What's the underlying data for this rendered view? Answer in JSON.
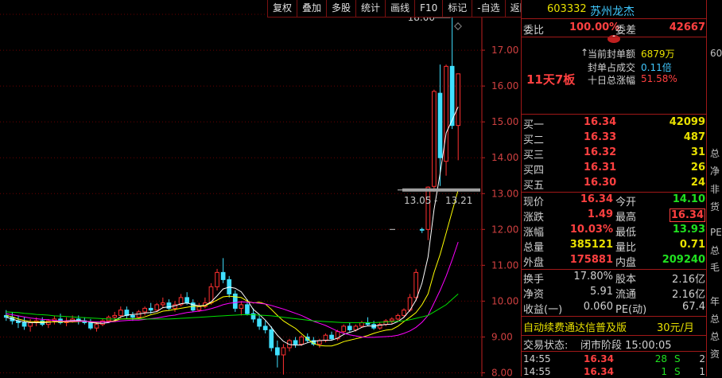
{
  "toolbar": [
    "复权",
    "叠加",
    "多股",
    "统计",
    "画线",
    "F10",
    "标记",
    "-自选",
    "返回"
  ],
  "stock": {
    "code": "603332",
    "name": "苏州龙杰"
  },
  "weibi": {
    "label": "委比",
    "pct": "100.00%",
    "diff_label": "委差",
    "diff": "42667"
  },
  "seal": {
    "amount_label": "当前封单额",
    "amount": "6879万",
    "ratio_label": "封单占成交",
    "ratio": "0.11倍",
    "gain_label": "十日总涨幅",
    "gain": "51.58%",
    "streak": "11天7板"
  },
  "bids": [
    {
      "label": "买一",
      "price": "16.34",
      "vol": "42099"
    },
    {
      "label": "买二",
      "price": "16.33",
      "vol": "487"
    },
    {
      "label": "买三",
      "price": "16.32",
      "vol": "31"
    },
    {
      "label": "买四",
      "price": "16.31",
      "vol": "26"
    },
    {
      "label": "买五",
      "price": "16.30",
      "vol": "24"
    }
  ],
  "quote": [
    {
      "l1": "现价",
      "v1": "16.34",
      "l2": "今开",
      "v2": "14.10"
    },
    {
      "l1": "涨跌",
      "v1": "1.49",
      "l2": "最高",
      "v2": "16.34"
    },
    {
      "l1": "涨幅",
      "v1": "10.03%",
      "l2": "最低",
      "v2": "13.93"
    },
    {
      "l1": "总量",
      "v1": "385121",
      "l2": "量比",
      "v2": "0.71"
    },
    {
      "l1": "外盘",
      "v1": "175881",
      "l2": "内盘",
      "v2": "209240"
    }
  ],
  "fund": [
    {
      "l1": "换手",
      "v1": "17.80%",
      "l2": "股本",
      "v2": "2.16亿"
    },
    {
      "l1": "净资",
      "v1": "5.91",
      "l2": "流通",
      "v2": "2.16亿"
    },
    {
      "l1": "收益(一)",
      "v1": "0.060",
      "l2": "PE(动)",
      "v2": "67.4"
    }
  ],
  "ad": {
    "text": "自动续费通达信普及版",
    "price": "30元/月"
  },
  "status": {
    "label": "交易状态:",
    "value": "闭市阶段 15:00:05"
  },
  "ticks": [
    {
      "time": "14:55",
      "price": "16.34",
      "vol": "28",
      "side": "S",
      "num": "2"
    },
    {
      "time": "14:55",
      "price": "16.34",
      "vol": "1",
      "side": "S",
      "num": "1"
    }
  ],
  "edge_chars": [
    "60",
    "总",
    "净",
    "非",
    "货",
    "PE",
    "总",
    "毛",
    "年",
    "总",
    "总",
    "资"
  ],
  "chart_data": {
    "type": "candlestick",
    "y_ticks": [
      "18.00",
      "17.00",
      "16.00",
      "15.00",
      "14.00",
      "13.00",
      "12.00",
      "11.00",
      "10.00",
      "9.00",
      "8.00"
    ],
    "ylim": [
      7.9,
      18.4
    ],
    "annotations": {
      "high": "18.00",
      "low_left": "13.05",
      "low_right": "13.21"
    },
    "candles": [
      [
        9.6,
        9.75,
        9.45,
        9.55
      ],
      [
        9.55,
        9.7,
        9.35,
        9.45
      ],
      [
        9.45,
        9.6,
        9.25,
        9.4
      ],
      [
        9.4,
        9.55,
        9.2,
        9.3
      ],
      [
        9.3,
        9.5,
        9.15,
        9.4
      ],
      [
        9.4,
        9.55,
        9.3,
        9.45
      ],
      [
        9.45,
        9.55,
        9.3,
        9.35
      ],
      [
        9.35,
        9.5,
        9.25,
        9.45
      ],
      [
        9.45,
        9.6,
        9.35,
        9.5
      ],
      [
        9.5,
        9.65,
        9.35,
        9.4
      ],
      [
        9.4,
        9.55,
        9.3,
        9.45
      ],
      [
        9.45,
        9.6,
        9.4,
        9.5
      ],
      [
        9.5,
        9.6,
        9.35,
        9.45
      ],
      [
        9.45,
        9.55,
        9.35,
        9.4
      ],
      [
        9.4,
        9.5,
        9.2,
        9.25
      ],
      [
        9.25,
        9.4,
        9.15,
        9.35
      ],
      [
        9.35,
        9.5,
        9.3,
        9.45
      ],
      [
        9.45,
        9.6,
        9.4,
        9.55
      ],
      [
        9.55,
        9.7,
        9.45,
        9.6
      ],
      [
        9.6,
        9.85,
        9.5,
        9.75
      ],
      [
        9.75,
        9.85,
        9.5,
        9.6
      ],
      [
        9.6,
        9.7,
        9.45,
        9.55
      ],
      [
        9.55,
        9.75,
        9.5,
        9.7
      ],
      [
        9.7,
        9.85,
        9.6,
        9.8
      ],
      [
        9.8,
        9.95,
        9.65,
        9.75
      ],
      [
        9.75,
        9.95,
        9.7,
        9.9
      ],
      [
        9.9,
        10.1,
        9.8,
        9.95
      ],
      [
        9.95,
        10.05,
        9.75,
        9.8
      ],
      [
        9.8,
        10.0,
        9.7,
        9.9
      ],
      [
        9.9,
        10.2,
        9.85,
        10.1
      ],
      [
        10.1,
        10.25,
        9.9,
        9.95
      ],
      [
        9.95,
        10.05,
        9.7,
        9.75
      ],
      [
        9.75,
        9.95,
        9.7,
        9.85
      ],
      [
        9.85,
        10.1,
        9.8,
        9.95
      ],
      [
        9.95,
        10.5,
        9.9,
        10.4
      ],
      [
        10.4,
        10.9,
        10.3,
        10.8
      ],
      [
        10.8,
        11.2,
        10.5,
        10.6
      ],
      [
        10.6,
        10.7,
        10.1,
        10.2
      ],
      [
        10.2,
        10.3,
        9.7,
        9.8
      ],
      [
        9.8,
        10.0,
        9.6,
        9.9
      ],
      [
        9.9,
        10.05,
        9.6,
        9.65
      ],
      [
        9.65,
        9.8,
        9.4,
        9.5
      ],
      [
        9.5,
        9.6,
        9.2,
        9.3
      ],
      [
        9.3,
        9.45,
        9.1,
        9.2
      ],
      [
        9.2,
        9.3,
        8.6,
        8.7
      ],
      [
        8.7,
        8.9,
        8.15,
        8.5
      ],
      [
        8.5,
        8.8,
        7.95,
        8.7
      ],
      [
        8.7,
        8.95,
        8.6,
        8.9
      ],
      [
        8.9,
        9.0,
        8.7,
        8.8
      ],
      [
        8.8,
        9.05,
        8.75,
        9.0
      ],
      [
        9.0,
        9.1,
        8.85,
        8.9
      ],
      [
        8.9,
        9.0,
        8.75,
        8.8
      ],
      [
        8.8,
        8.95,
        8.7,
        8.9
      ],
      [
        8.9,
        9.1,
        8.85,
        9.05
      ],
      [
        9.05,
        9.15,
        8.9,
        8.95
      ],
      [
        8.95,
        9.2,
        8.9,
        9.15
      ],
      [
        9.15,
        9.35,
        9.1,
        9.3
      ],
      [
        9.3,
        9.4,
        9.15,
        9.2
      ],
      [
        9.2,
        9.35,
        9.15,
        9.3
      ],
      [
        9.3,
        9.45,
        9.25,
        9.4
      ],
      [
        9.4,
        9.55,
        9.3,
        9.35
      ],
      [
        9.35,
        9.45,
        9.2,
        9.25
      ],
      [
        9.25,
        9.4,
        9.2,
        9.35
      ],
      [
        9.35,
        9.5,
        9.3,
        9.45
      ],
      [
        9.45,
        9.55,
        9.35,
        9.5
      ],
      [
        9.5,
        9.65,
        9.45,
        9.6
      ],
      [
        9.6,
        9.8,
        9.55,
        9.75
      ],
      [
        9.75,
        10.2,
        9.7,
        10.1
      ],
      [
        10.1,
        10.9,
        10.0,
        10.8
      ],
      [
        12.0,
        12.05,
        11.9,
        11.98
      ],
      [
        12.0,
        13.2,
        11.7,
        13.18
      ],
      [
        13.2,
        15.9,
        13.05,
        15.85
      ],
      [
        15.8,
        16.6,
        13.21,
        14.0
      ],
      [
        13.9,
        16.6,
        13.5,
        16.55
      ],
      [
        16.55,
        18.0,
        14.8,
        14.9
      ],
      [
        14.9,
        16.34,
        13.93,
        16.34
      ]
    ],
    "ma": {
      "MA5": {
        "color": "#ffffff",
        "values": [
          9.55,
          9.5,
          9.45,
          9.42,
          9.4,
          9.4,
          9.4,
          9.41,
          9.43,
          9.43,
          9.45,
          9.46,
          9.46,
          9.45,
          9.41,
          9.38,
          9.38,
          9.4,
          9.46,
          9.56,
          9.61,
          9.63,
          9.64,
          9.67,
          9.68,
          9.71,
          9.82,
          9.84,
          9.87,
          9.93,
          9.95,
          9.9,
          9.87,
          9.88,
          9.98,
          10.15,
          10.34,
          10.39,
          10.36,
          10.26,
          10.03,
          9.77,
          9.63,
          9.47,
          9.27,
          9.05,
          8.88,
          8.79,
          8.77,
          8.78,
          8.84,
          8.88,
          8.9,
          8.91,
          8.91,
          8.97,
          9.07,
          9.13,
          9.18,
          9.27,
          9.31,
          9.3,
          9.33,
          9.35,
          9.36,
          9.43,
          9.55,
          9.75,
          10.03,
          10.5,
          11.23,
          12.56,
          13.56,
          14.69,
          15.05,
          15.42
        ]
      },
      "MA10": {
        "color": "#ffff00",
        "values": [
          9.6,
          9.56,
          9.5,
          9.46,
          9.43,
          9.42,
          9.42,
          9.42,
          9.42,
          9.42,
          9.42,
          9.42,
          9.43,
          9.44,
          9.42,
          9.41,
          9.42,
          9.43,
          9.45,
          9.5,
          9.51,
          9.51,
          9.52,
          9.56,
          9.62,
          9.66,
          9.72,
          9.74,
          9.77,
          9.8,
          9.83,
          9.86,
          9.85,
          9.87,
          9.95,
          10.03,
          10.12,
          10.14,
          10.12,
          10.1,
          10.0,
          9.95,
          9.97,
          9.92,
          9.77,
          9.6,
          9.45,
          9.34,
          9.24,
          9.09,
          8.95,
          8.82,
          8.76,
          8.75,
          8.75,
          8.8,
          8.87,
          8.91,
          8.95,
          8.99,
          9.04,
          9.1,
          9.15,
          9.19,
          9.21,
          9.3,
          9.43,
          9.55,
          9.68,
          9.9,
          10.2,
          10.8,
          11.3,
          11.9,
          12.5,
          13.1
        ]
      },
      "MA20": {
        "color": "#ff00ff",
        "values": [
          9.65,
          9.62,
          9.59,
          9.56,
          9.53,
          9.51,
          9.49,
          9.48,
          9.46,
          9.45,
          9.44,
          9.44,
          9.44,
          9.44,
          9.43,
          9.42,
          9.42,
          9.42,
          9.43,
          9.45,
          9.46,
          9.47,
          9.47,
          9.49,
          9.51,
          9.53,
          9.56,
          9.59,
          9.61,
          9.65,
          9.68,
          9.7,
          9.72,
          9.75,
          9.79,
          9.84,
          9.9,
          9.94,
          9.96,
          9.98,
          9.97,
          9.96,
          9.94,
          9.92,
          9.88,
          9.83,
          9.78,
          9.72,
          9.66,
          9.6,
          9.52,
          9.44,
          9.38,
          9.32,
          9.24,
          9.16,
          9.1,
          9.06,
          9.03,
          9.0,
          8.99,
          8.99,
          9.0,
          9.01,
          9.02,
          9.05,
          9.1,
          9.17,
          9.27,
          9.41,
          9.6,
          9.95,
          10.3,
          10.7,
          11.15,
          11.65
        ]
      },
      "MA60": {
        "color": "#00e000",
        "values": [
          9.7,
          9.69,
          9.68,
          9.66,
          9.65,
          9.63,
          9.62,
          9.61,
          9.59,
          9.58,
          9.57,
          9.56,
          9.55,
          9.54,
          9.53,
          9.52,
          9.51,
          9.5,
          9.5,
          9.5,
          9.5,
          9.5,
          9.5,
          9.5,
          9.5,
          9.5,
          9.5,
          9.5,
          9.51,
          9.52,
          9.53,
          9.54,
          9.55,
          9.56,
          9.57,
          9.58,
          9.59,
          9.6,
          9.61,
          9.62,
          9.62,
          9.62,
          9.61,
          9.6,
          9.59,
          9.57,
          9.55,
          9.53,
          9.51,
          9.49,
          9.47,
          9.45,
          9.44,
          9.43,
          9.42,
          9.41,
          9.4,
          9.4,
          9.4,
          9.4,
          9.4,
          9.4,
          9.41,
          9.42,
          9.43,
          9.44,
          9.45,
          9.48,
          9.52,
          9.56,
          9.6,
          9.7,
          9.8,
          9.9,
          10.05,
          10.2
        ]
      }
    }
  }
}
